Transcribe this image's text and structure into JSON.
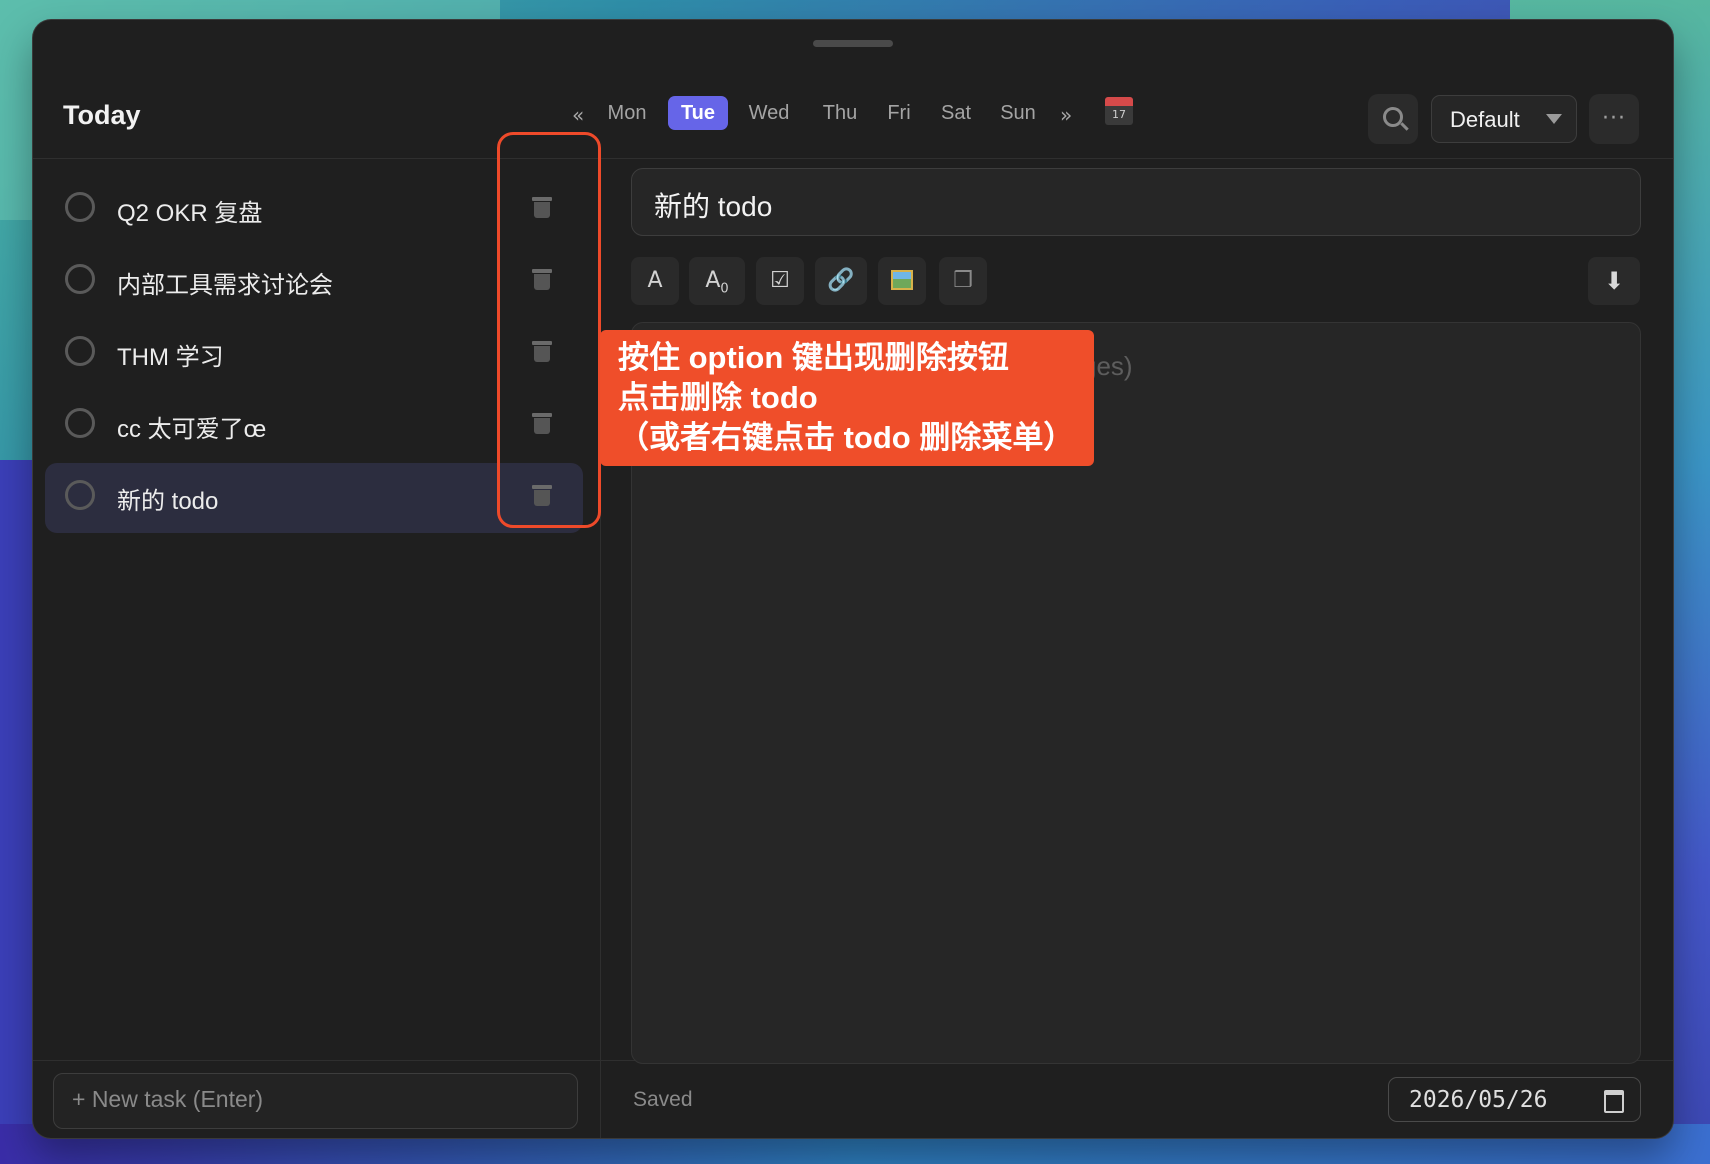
{
  "header": {
    "title": "Today",
    "prev_label": "«",
    "next_label": "»",
    "days": [
      "Mon",
      "Tue",
      "Wed",
      "Thu",
      "Fri",
      "Sat",
      "Sun"
    ],
    "active_day": "Tue",
    "calendar_day": "17",
    "list_select_value": "Default",
    "more_label": "···"
  },
  "tasks": [
    {
      "label": "Q2 OKR 复盘",
      "done": false,
      "selected": false
    },
    {
      "label": "内部工具需求讨论会",
      "done": false,
      "selected": false
    },
    {
      "label": "THM 学习",
      "done": false,
      "selected": false
    },
    {
      "label": "cc 太可爱了œ",
      "done": false,
      "selected": false
    },
    {
      "label": "新的 todo",
      "done": false,
      "selected": true
    }
  ],
  "new_task_placeholder": "+ New task (Enter)",
  "editor": {
    "title_value": "新的 todo",
    "placeholder_visible": "ges)",
    "toolbar": {
      "text": "A",
      "text_size": "A",
      "text_size_sub": "0",
      "checkbox": "☑",
      "link": "🔗"
    },
    "download_label": "⬇"
  },
  "status": {
    "saved": "Saved",
    "date": "2026/05/26"
  },
  "callout": {
    "line1": "按住 option 键出现删除按钮",
    "line2": "点击删除 todo",
    "line3": "（或者右键点击 todo 删除菜单）"
  },
  "colors": {
    "accent": "#6665e8",
    "callout": "#ef4e2a",
    "highlight_border": "#ee4a2a"
  }
}
